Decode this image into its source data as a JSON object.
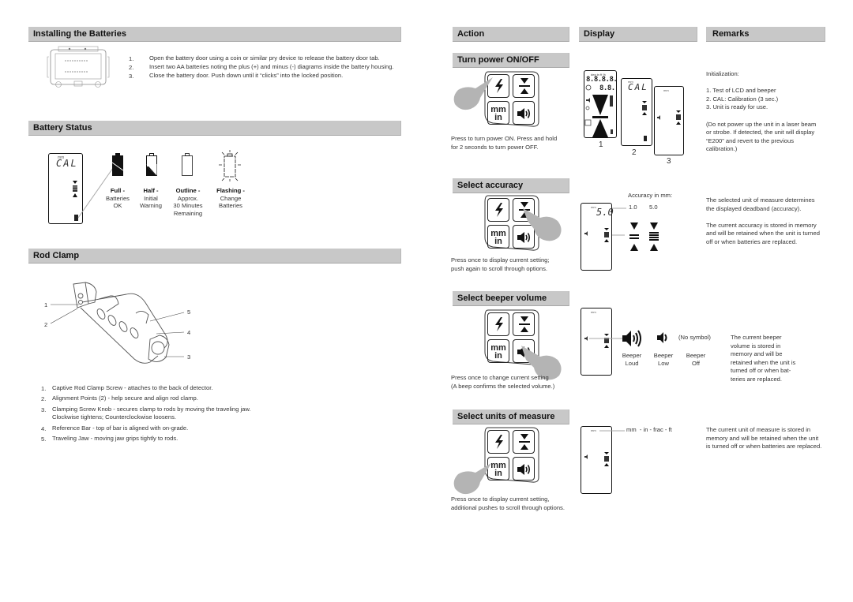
{
  "left": {
    "installing": {
      "title": "Installing the Batteries",
      "steps": [
        {
          "n": "1.",
          "text": "Open the battery door using a coin or similar pry device to release the battery door tab."
        },
        {
          "n": "2.",
          "text": "Insert two AA batteries noting the plus (+) and minus (-) diagrams inside the battery housing."
        },
        {
          "n": "3.",
          "text": "Close the battery door. Push down until it “clicks” into the locked position."
        }
      ]
    },
    "battery_status": {
      "title": "Battery Status",
      "lcd_text": "CAL",
      "lcd_unit": "mm",
      "states": [
        {
          "title": "Full -",
          "lines": [
            "Batteries",
            "OK"
          ],
          "icon": "battery-full-icon"
        },
        {
          "title": "Half -",
          "lines": [
            "Initial",
            "Warning"
          ],
          "icon": "battery-half-icon"
        },
        {
          "title": "Outline -",
          "lines": [
            "Approx.",
            "30 Minutes",
            "Remaining"
          ],
          "icon": "battery-empty-icon"
        },
        {
          "title": "Flashing -",
          "lines": [
            "Change",
            "Batteries"
          ],
          "icon": "battery-flashing-icon"
        }
      ]
    },
    "rod_clamp": {
      "title": "Rod Clamp",
      "callouts": [
        "1",
        "2",
        "3",
        "4",
        "5"
      ],
      "items": [
        {
          "n": "1.",
          "text": "Captive Rod Clamp Screw - attaches to the back of detector."
        },
        {
          "n": "2.",
          "text": "Alignment Points (2) - help secure and align rod clamp."
        },
        {
          "n": "3.",
          "text": "Clamping Screw Knob - secures clamp to rods by moving the traveling jaw.",
          "text2": "Clockwise tightens; Counterclockwise loosens."
        },
        {
          "n": "4.",
          "text": "Reference Bar - top of bar is aligned with on-grade."
        },
        {
          "n": "5.",
          "text": "Traveling Jaw - moving jaw grips tightly to rods."
        }
      ]
    }
  },
  "right": {
    "columns": {
      "action": "Action",
      "display": "Display",
      "remarks": "Remarks"
    },
    "keypad": {
      "mm": "mm",
      "in": "in"
    },
    "power": {
      "title": "Turn power ON/OFF",
      "caption": [
        "Press to turn power ON. Press and hold",
        "for 2 seconds to turn power OFF."
      ],
      "display_labels": [
        "1",
        "2",
        "3"
      ],
      "lcd2_text": "CAL",
      "lcd_unit": "mm",
      "lcd1_top": "8.8.8.8.",
      "lcd1_mid": "8.8.",
      "lcd1_units": "deg in ft %",
      "remarks": [
        "Initialization:",
        "",
        "1. Test of LCD and beeper",
        "2. CAL: Calibration (3 sec.)",
        "3. Unit is ready for use.",
        "",
        "(Do not power up the unit in a laser beam",
        "or strobe. If detected, the unit will display",
        "“E200” and revert to the previous",
        "calibration.)"
      ]
    },
    "accuracy": {
      "title": "Select accuracy",
      "caption": [
        "Press once to display current setting;",
        "push again to scroll through options."
      ],
      "lcd_value": "5.0",
      "lcd_unit": "mm",
      "label": "Accuracy in mm:",
      "options": [
        "1.0",
        "5.0"
      ],
      "remarks": [
        "The selected unit of measure determines",
        "the displayed deadband (accuracy).",
        "",
        "The current accuracy is stored in memory",
        "and will be retained when the unit is turned",
        "off or when batteries are replaced."
      ]
    },
    "beeper": {
      "title": "Select beeper volume",
      "caption": [
        "Press once to change current setting",
        "(A beep confirms the selected volume.)"
      ],
      "lcd_unit": "mm",
      "no_symbol": "(No symbol)",
      "options": [
        {
          "lines": [
            "Beeper",
            "Loud"
          ]
        },
        {
          "lines": [
            "Beeper",
            "Low"
          ]
        },
        {
          "lines": [
            "Beeper",
            "Off"
          ]
        }
      ],
      "remarks": [
        "The current beeper",
        "volume is stored in",
        "memory and will be",
        "retained when the unit is",
        "turned off or when bat-",
        "teries are replaced."
      ]
    },
    "units": {
      "title": "Select units of measure",
      "caption": [
        "Press once to display current setting,",
        "additional pushes to scroll through options."
      ],
      "lcd_unit": "mm",
      "options_label": "mm  - in - frac - ft",
      "remarks": [
        "The current unit of measure is stored in",
        "memory and will be retained when the unit",
        "is turned off or when batteries are replaced."
      ]
    }
  },
  "colors": {
    "header_bg": "#c8c8c8",
    "hand": "#b4b4b4",
    "ink": "#111111"
  }
}
